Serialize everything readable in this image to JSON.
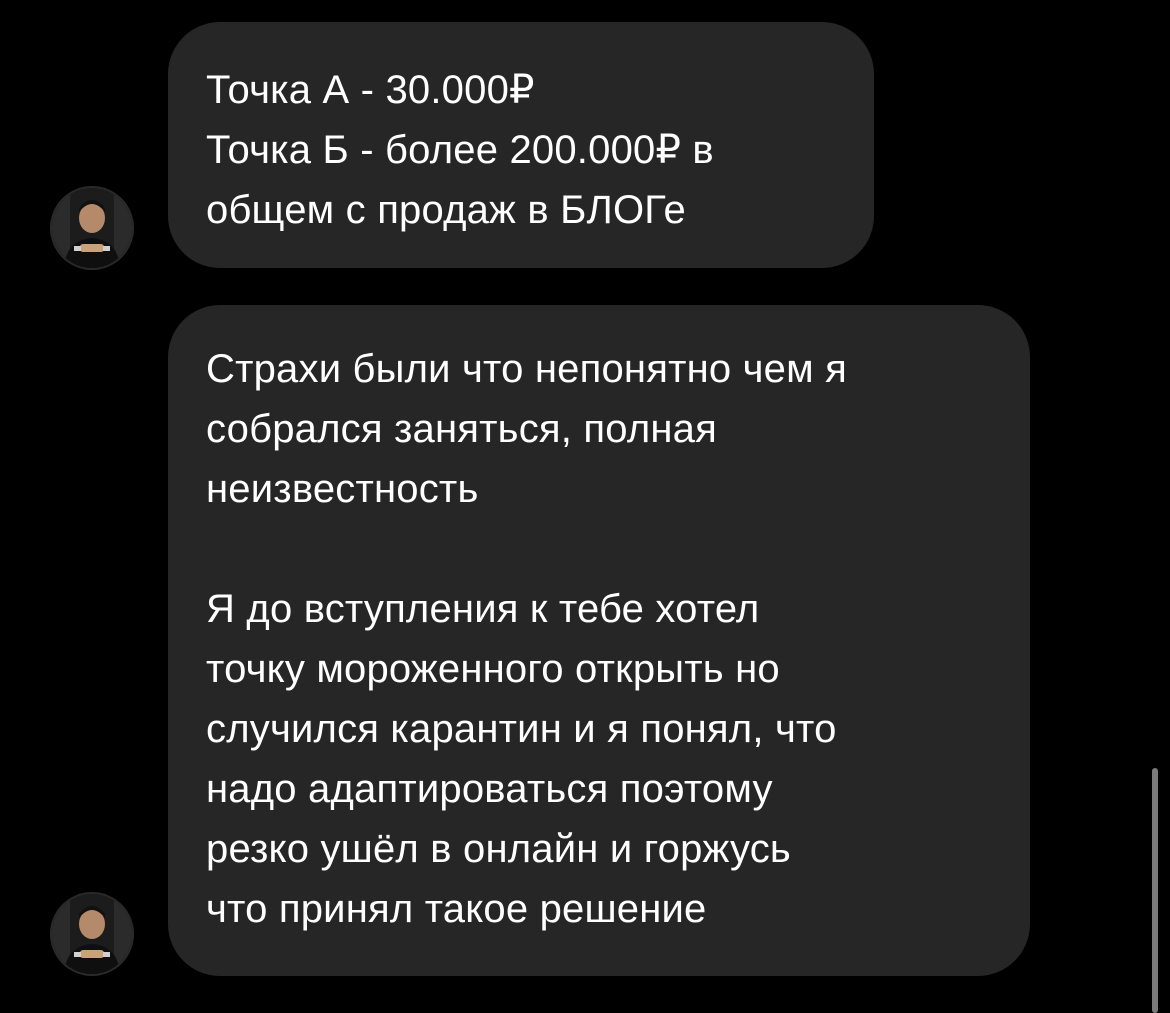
{
  "conversation": {
    "messages": [
      {
        "lines": [
          "Точка А - 30.000₽",
          "Точка Б - более 200.000₽ в",
          "общем с продаж в БЛОГе"
        ]
      },
      {
        "paragraphs": [
          [
            "Страхи были что непонятно чем я",
            "собрался заняться, полная",
            "неизвестность"
          ],
          [
            "Я до вступления к тебе хотел",
            "точку мороженного открыть но",
            "случился карантин и я понял, что",
            "надо адаптироваться поэтому",
            "резко ушёл в онлайн и горжусь",
            "что принял такое решение"
          ]
        ]
      }
    ],
    "avatar_icon": "user-avatar-photo"
  },
  "colors": {
    "background": "#000000",
    "bubble": "#262626",
    "text": "#ffffff",
    "scrollbar": "#7a7a7a"
  }
}
